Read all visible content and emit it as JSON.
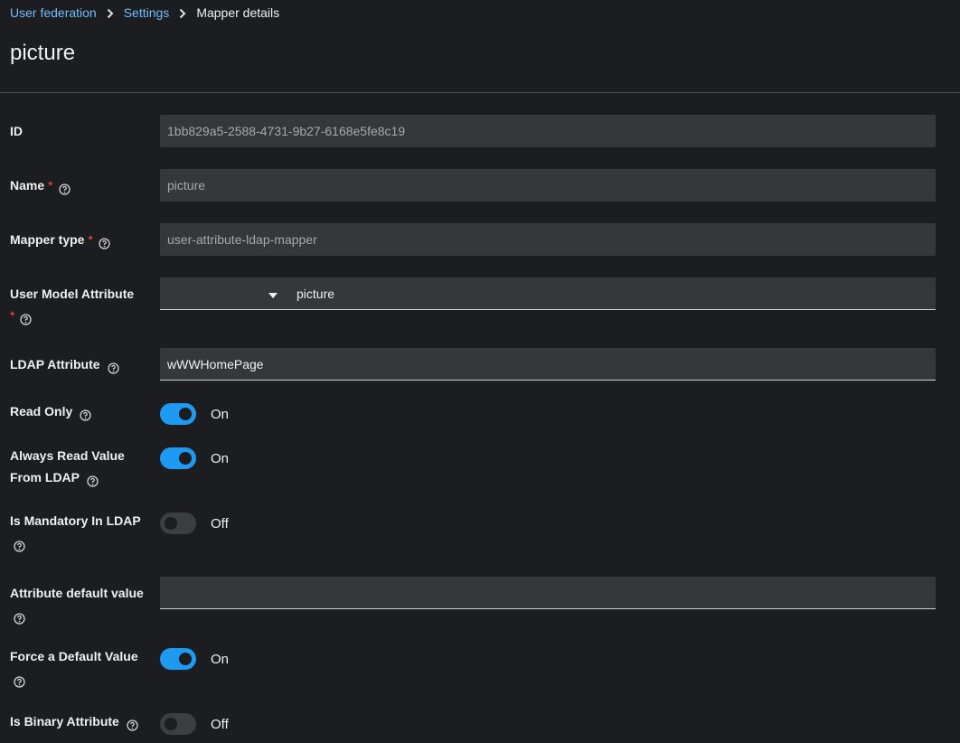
{
  "breadcrumb": {
    "items": [
      {
        "label": "User federation"
      },
      {
        "label": "Settings"
      }
    ],
    "current": "Mapper details"
  },
  "page": {
    "title": "picture"
  },
  "form": {
    "id": {
      "label": "ID",
      "value": "1bb829a5-2588-4731-9b27-6168e5fe8c19"
    },
    "name": {
      "label": "Name",
      "required_mark": "*",
      "value": "picture"
    },
    "mapper_type": {
      "label": "Mapper type",
      "required_mark": "*",
      "value": "user-attribute-ldap-mapper"
    },
    "user_model_attribute": {
      "label": "User Model Attribute",
      "required_mark": "*",
      "value": "picture"
    },
    "ldap_attribute": {
      "label": "LDAP Attribute",
      "value": "wWWHomePage"
    },
    "read_only": {
      "label": "Read Only",
      "state": "On",
      "on": true
    },
    "always_read_value": {
      "label_line1": "Always Read Value",
      "label_line2": "From LDAP",
      "state": "On",
      "on": true
    },
    "is_mandatory": {
      "label": "Is Mandatory In LDAP",
      "state": "Off",
      "on": false
    },
    "attribute_default": {
      "label": "Attribute default value",
      "value": ""
    },
    "force_default": {
      "label": "Force a Default Value",
      "state": "On",
      "on": true
    },
    "is_binary": {
      "label": "Is Binary Attribute",
      "state": "Off",
      "on": false
    }
  },
  "colors": {
    "background": "#1b1d21",
    "link": "#73bcf7",
    "switch_on": "#1f9af3",
    "required": "#fe5142"
  }
}
